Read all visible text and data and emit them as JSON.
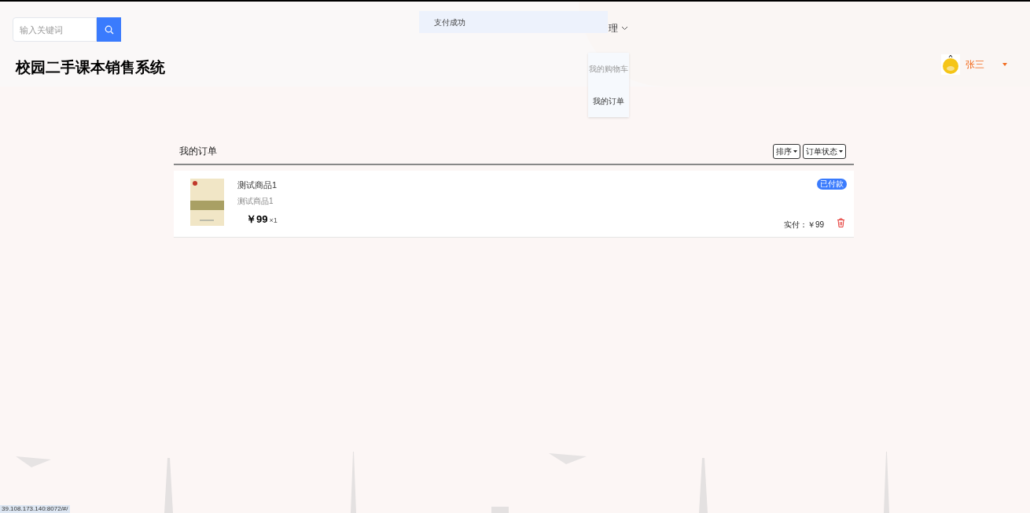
{
  "header": {
    "search": {
      "placeholder": "输入关键词"
    },
    "site_title": "校园二手课本销售系统",
    "nav_fragment": "理",
    "user": {
      "name": "张三"
    }
  },
  "toast": {
    "text": "支付成功"
  },
  "dropdown_menu": {
    "items": [
      {
        "label": "我的购物车",
        "hovered": false
      },
      {
        "label": "我的订单",
        "hovered": true
      }
    ]
  },
  "orders": {
    "title": "我的订单",
    "filters": [
      "排序",
      "订单状态"
    ],
    "items": [
      {
        "kind": "picture",
        "name": "测试商品1",
        "subtitle": "测试商品1",
        "price": "￥99",
        "quantity": "×1",
        "status": "已付款",
        "paid_label": "实付：",
        "paid": "￥99"
      }
    ]
  },
  "status_url": "39.108.173.140:8072/#/"
}
